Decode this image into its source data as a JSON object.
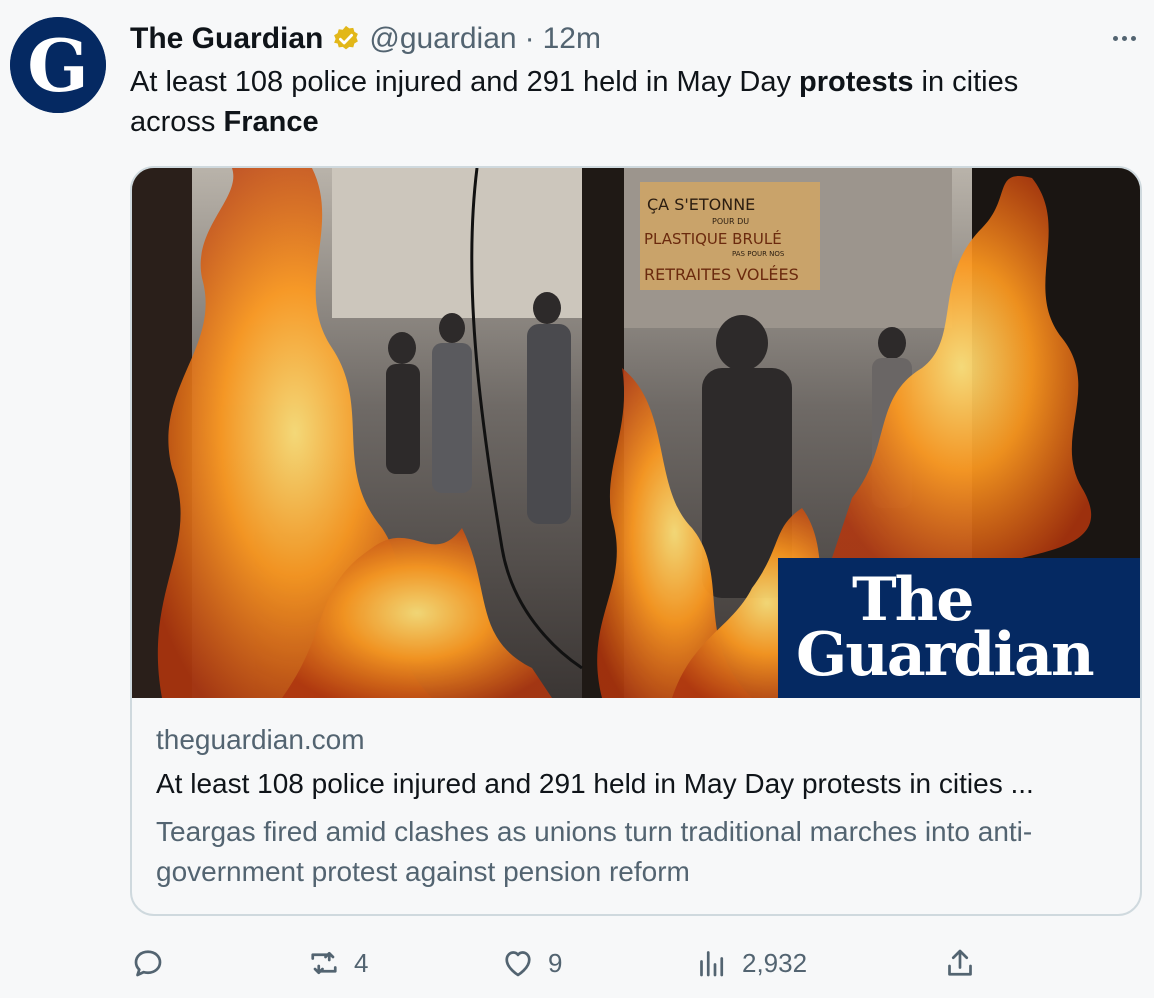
{
  "account": {
    "avatar_letter": "G",
    "display_name": "The Guardian",
    "handle": "@guardian",
    "separator": "·",
    "time": "12m"
  },
  "tweet": {
    "text_parts": [
      {
        "text": "At least 108 police injured and 291 held in May Day ",
        "bold": false
      },
      {
        "text": "protests",
        "bold": true
      },
      {
        "text": " in cities across ",
        "bold": false
      },
      {
        "text": "France",
        "bold": true
      }
    ]
  },
  "card": {
    "image_sign_lines": [
      "ÇA S'ETONNE",
      "POUR DU",
      "PLASTIQUE BRULÉ",
      "PAS POUR NOS",
      "RETRAITES VOLÉES"
    ],
    "brand_line1": "The",
    "brand_line2": "Guardian",
    "domain": "theguardian.com",
    "title": "At least 108 police injured and 291 held in May Day protests in cities ...",
    "description": "Teargas fired amid clashes as unions turn traditional marches into anti-government protest against pension reform"
  },
  "actions": {
    "reply_count": "",
    "retweet_count": "4",
    "like_count": "9",
    "views_count": "2,932"
  },
  "colors": {
    "brand_blue": "#052962",
    "verified_gold": "#e2b719",
    "secondary_text": "#536471",
    "border": "#cfd9de"
  },
  "icons": [
    "verified-badge-icon",
    "more-icon",
    "reply-icon",
    "retweet-icon",
    "like-icon",
    "views-icon",
    "share-icon"
  ]
}
